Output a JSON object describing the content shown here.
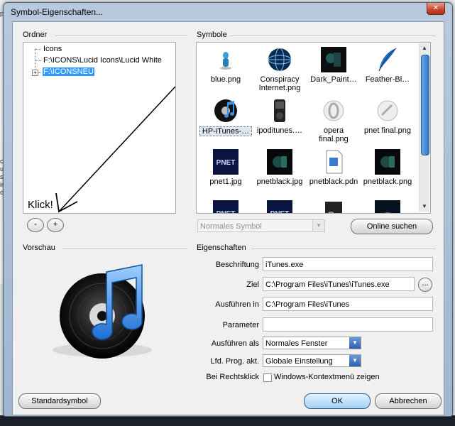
{
  "window": {
    "title": "Symbol-Eigenschaften..."
  },
  "background": {
    "left_fragments": [
      "ply",
      "co",
      "us",
      "s",
      "in",
      "o"
    ]
  },
  "folders": {
    "label": "Ordner",
    "items": [
      {
        "label": "Icons"
      },
      {
        "label": "F:\\ICONS\\Lucid Icons\\Lucid White"
      },
      {
        "label": "F:\\ICONSNEU"
      }
    ],
    "annotation": "Klick!",
    "remove_label": "-",
    "add_label": "+"
  },
  "symbols": {
    "label": "Symbole",
    "items": [
      {
        "name": "blue.png",
        "icon": "blue-figure-icon"
      },
      {
        "name": "Conspiracy\nInternet.png",
        "icon": "globe-icon"
      },
      {
        "name": "Dark_Paint…",
        "icon": "dark-paint-icon"
      },
      {
        "name": "Feather-Bl…",
        "icon": "feather-icon"
      },
      {
        "name": "HP-iTunes-…",
        "icon": "itunes-icon"
      },
      {
        "name": "ipoditunes.…",
        "icon": "ipod-icon"
      },
      {
        "name": "opera\nfinal.png",
        "icon": "opera-icon"
      },
      {
        "name": "pnet final.png",
        "icon": "pnet-final-icon"
      },
      {
        "name": "pnet1.jpg",
        "icon": "pnet-icon"
      },
      {
        "name": "pnetblack.jpg",
        "icon": "pnetblack-icon"
      },
      {
        "name": "pnetblack.pdn",
        "icon": "pdn-file-icon"
      },
      {
        "name": "pnetblack.png",
        "icon": "pnetblack-icon"
      },
      {
        "name": "",
        "icon": "pnet-icon"
      },
      {
        "name": "",
        "icon": "pnet-icon"
      },
      {
        "name": "",
        "icon": "photoshop-icon"
      },
      {
        "name": "",
        "icon": "dark-icon"
      }
    ],
    "size_select": "Normales Symbol",
    "online_button": "Online suchen"
  },
  "preview": {
    "label": "Vorschau",
    "icon": "itunes-large-icon"
  },
  "properties": {
    "label": "Eigenschaften",
    "caption_label": "Beschriftung",
    "caption_value": "iTunes.exe",
    "target_label": "Ziel",
    "target_value": "C:\\Program Files\\iTunes\\iTunes.exe",
    "browse_label": "...",
    "startin_label": "Ausführen in",
    "startin_value": "C:\\Program Files\\iTunes",
    "params_label": "Parameter",
    "params_value": "",
    "runas_label": "Ausführen als",
    "runas_value": "Normales Fenster",
    "prog_label": "Lfd. Prog. akt.",
    "prog_value": "Globale Einstellung",
    "rightclick_label": "Bei Rechtsklick",
    "rightclick_checkbox": "Windows-Kontextmenü zeigen"
  },
  "buttons": {
    "default_symbol": "Standardsymbol",
    "ok": "OK",
    "cancel": "Abbrechen"
  },
  "colors": {
    "accent": "#3399ff",
    "ok_button": "#bfe0f8",
    "title_bar": "#b8c9dc"
  }
}
